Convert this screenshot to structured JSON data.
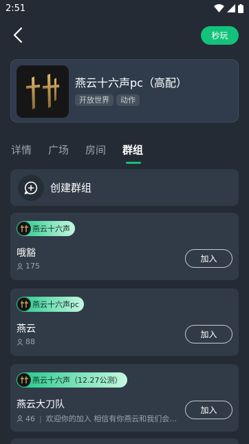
{
  "status_bar": {
    "time": "2:51"
  },
  "header": {
    "quick_play_label": "秒玩"
  },
  "game": {
    "title": "燕云十六声pc（高配）",
    "tags": [
      "开放世界",
      "动作"
    ]
  },
  "tabs": [
    {
      "label": "详情",
      "active": false
    },
    {
      "label": "广场",
      "active": false
    },
    {
      "label": "房间",
      "active": false
    },
    {
      "label": "群组",
      "active": true
    }
  ],
  "create_group": {
    "label": "创建群组"
  },
  "groups": [
    {
      "game_tag": "燕云十六声",
      "name": "哦豁",
      "members": "175",
      "description": "",
      "join_label": "加入"
    },
    {
      "game_tag": "燕云十六声pc",
      "name": "燕云",
      "members": "88",
      "description": "",
      "join_label": "加入"
    },
    {
      "game_tag": "燕云十六声（12.27公测）",
      "name": "燕云大刀队",
      "members": "46",
      "description": "欢迎你的加入  相信有你燕云和我们会…",
      "join_label": "加入"
    }
  ],
  "colors": {
    "background": "#242b34",
    "card": "#313b47",
    "accent": "#13c27b",
    "tag_gradient_start": "#1fc98a",
    "tag_gradient_end": "#c5f7e0"
  },
  "icons": {
    "back": "chevron-left-icon",
    "wifi": "wifi-icon",
    "signal": "signal-icon",
    "battery": "battery-icon",
    "create": "add-chat-icon",
    "members": "person-icon"
  }
}
